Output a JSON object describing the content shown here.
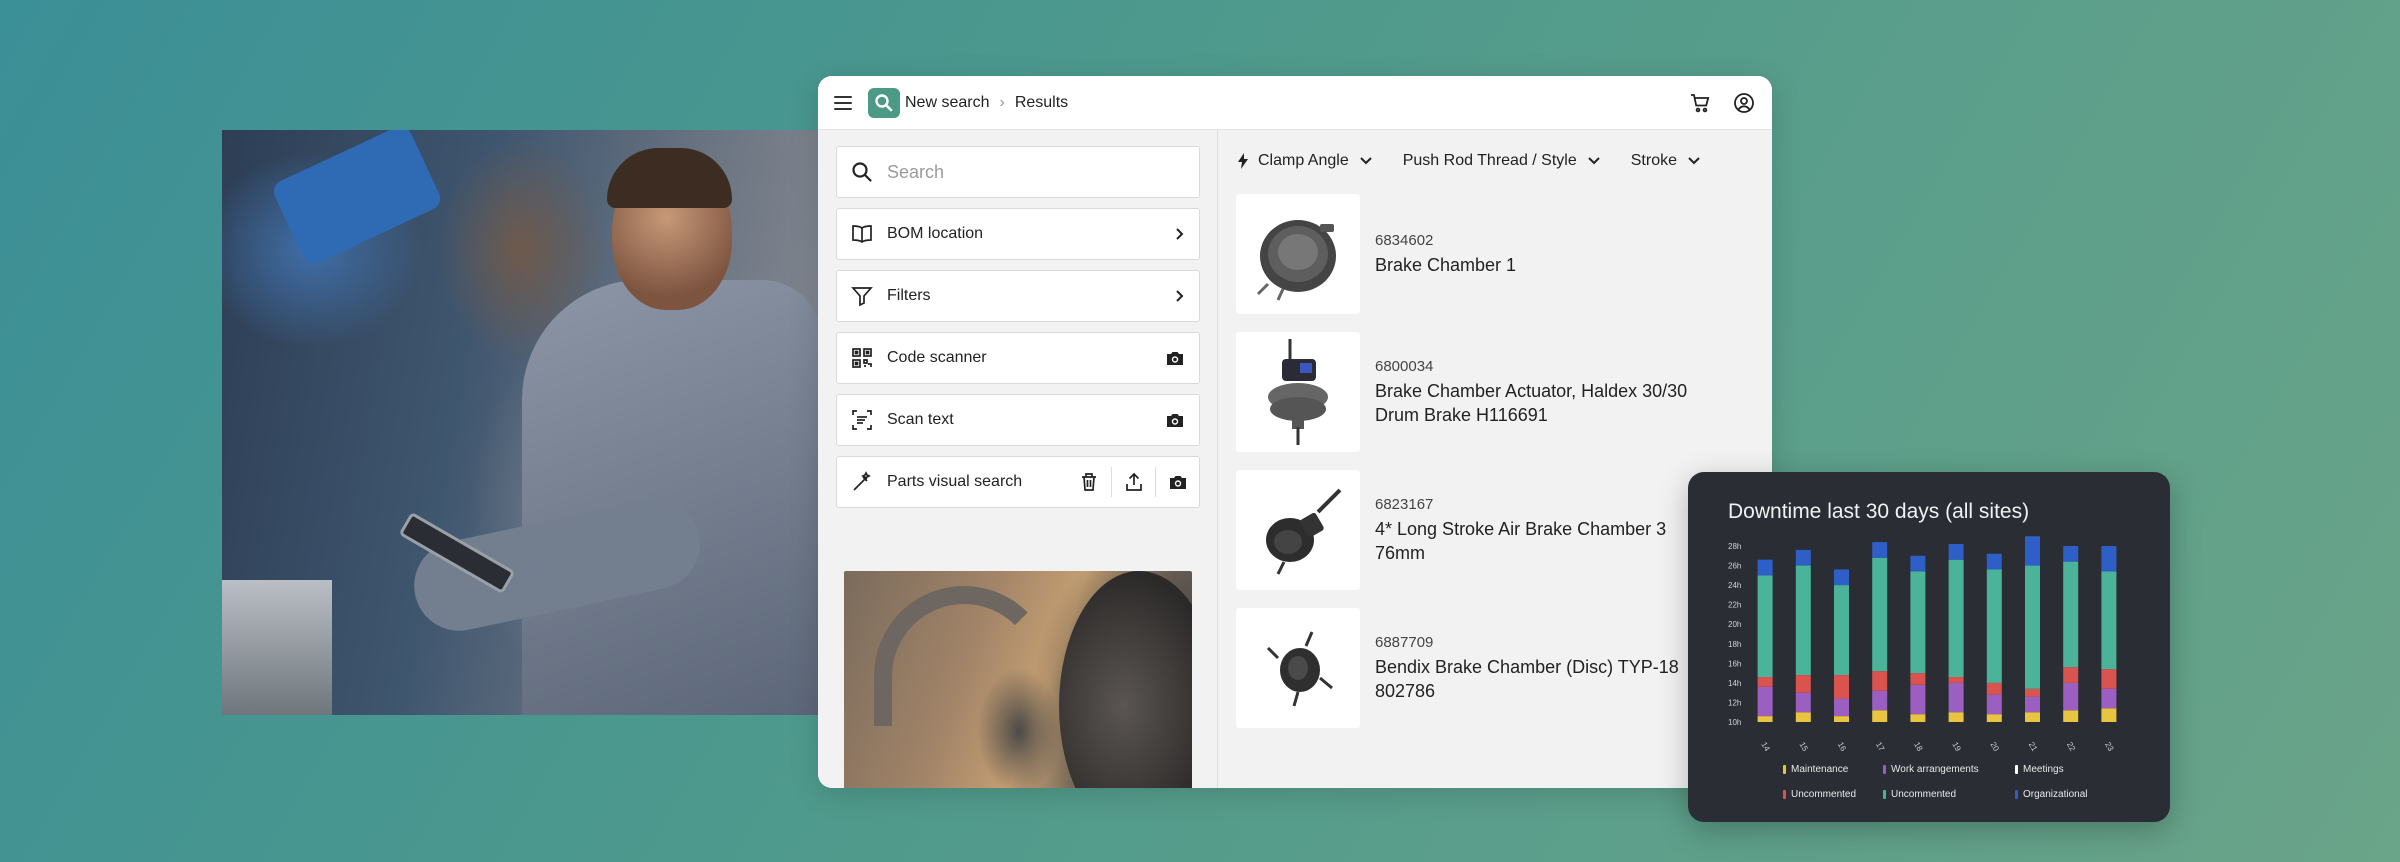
{
  "app": {
    "breadcrumb": {
      "root": "New search",
      "current": "Results"
    }
  },
  "left_panel": {
    "search": {
      "placeholder": "Search"
    },
    "items": [
      {
        "label": "BOM location"
      },
      {
        "label": "Filters"
      },
      {
        "label": "Code scanner"
      },
      {
        "label": "Scan text"
      },
      {
        "label": "Parts visual search"
      }
    ]
  },
  "filters": [
    {
      "label": "Clamp Angle"
    },
    {
      "label": "Push Rod Thread / Style"
    },
    {
      "label": "Stroke"
    }
  ],
  "results": [
    {
      "part_number": "6834602",
      "name_lines": [
        "Brake Chamber 1"
      ]
    },
    {
      "part_number": "6800034",
      "name_lines": [
        "Brake Chamber Actuator, Haldex 30/30",
        "Drum Brake H116691"
      ]
    },
    {
      "part_number": "6823167",
      "name_lines": [
        "4* Long Stroke Air Brake Chamber 3",
        "76mm"
      ]
    },
    {
      "part_number": "6887709",
      "name_lines": [
        "Bendix Brake Chamber (Disc) TYP-18",
        "802786"
      ]
    }
  ],
  "colors": {
    "brand": "#4a9a86",
    "card_bg": "#2b2d35"
  },
  "chart_data": {
    "type": "bar",
    "stacked": true,
    "title": "Downtime last 30 days (all sites)",
    "ylim": [
      10,
      28
    ],
    "y_ticks": [
      "10h",
      "12h",
      "14h",
      "16h",
      "18h",
      "20h",
      "22h",
      "24h",
      "26h",
      "28h"
    ],
    "categories": [
      "14",
      "15",
      "16",
      "17",
      "18",
      "19",
      "20",
      "21",
      "22",
      "23"
    ],
    "series": [
      {
        "name": "Maintenance",
        "color": "#e8c441",
        "values": [
          0.6,
          1.0,
          0.6,
          1.2,
          0.8,
          1.0,
          0.8,
          1.0,
          1.2,
          1.4
        ]
      },
      {
        "name": "Work arrangements",
        "color": "#9b5fc1",
        "values": [
          3.0,
          2.0,
          1.8,
          2.0,
          3.0,
          3.0,
          2.0,
          1.6,
          2.8,
          2.0
        ]
      },
      {
        "name": "Meetings",
        "color": "#ffffff",
        "values": [
          0,
          0,
          0,
          0,
          0,
          0,
          0,
          0,
          0,
          0
        ]
      },
      {
        "name": "Uncommented",
        "color": "#d9534f",
        "values": [
          1.0,
          1.8,
          2.4,
          2.0,
          1.2,
          0.6,
          1.2,
          0.8,
          1.6,
          2.0
        ]
      },
      {
        "name": "Uncommented",
        "color": "#4bb39a",
        "values": [
          10.4,
          11.2,
          9.2,
          11.6,
          10.4,
          12.0,
          11.6,
          12.6,
          10.8,
          10.0
        ]
      },
      {
        "name": "Organizational",
        "color": "#2e5fc6",
        "values": [
          1.6,
          1.6,
          1.6,
          1.6,
          1.6,
          1.6,
          1.6,
          3.0,
          1.6,
          2.6
        ]
      }
    ],
    "legend_position": "bottom",
    "grid": false
  }
}
